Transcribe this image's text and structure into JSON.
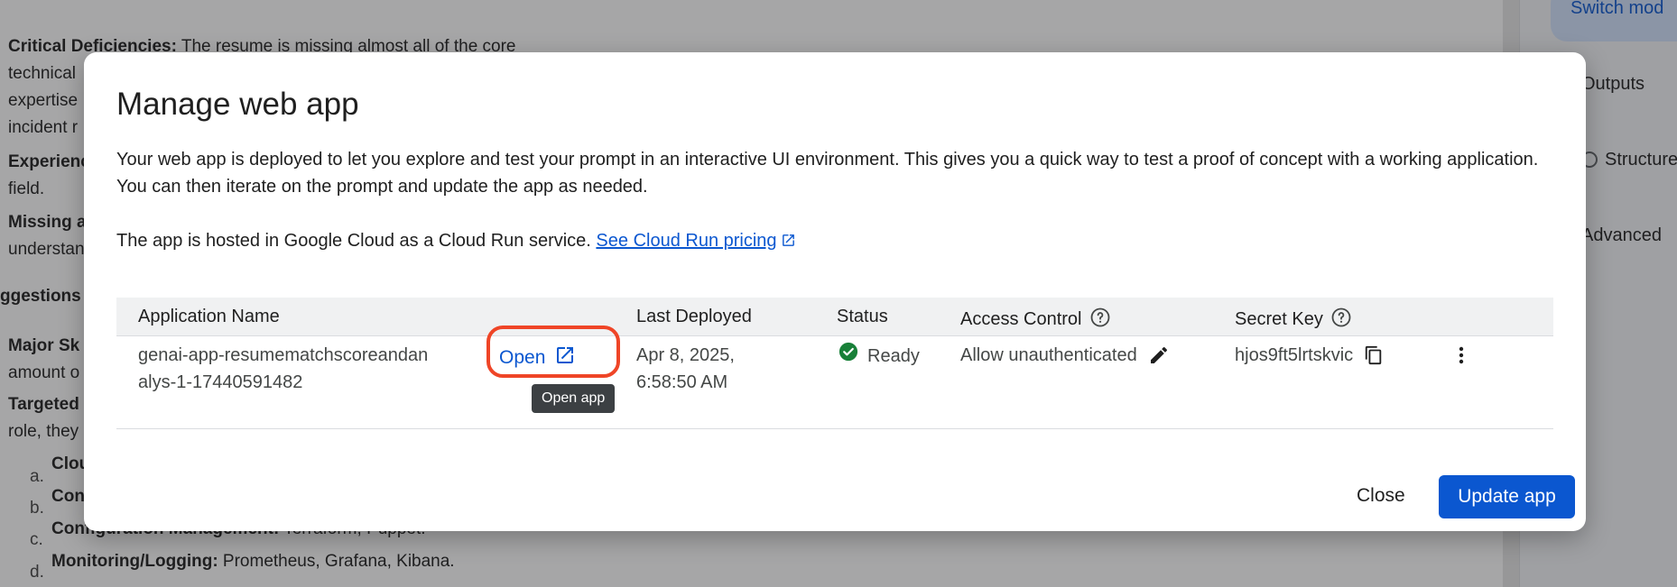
{
  "background": {
    "paragraphs": [
      {
        "bold": "Critical Deficiencies:",
        "text": " The resume is missing almost all of the core"
      },
      {
        "bold": "",
        "text": "technical"
      },
      {
        "bold": "",
        "text": "expertise"
      },
      {
        "bold": "",
        "text": "incident r"
      },
      {
        "bold": "Experienc",
        "text": ""
      },
      {
        "bold": "",
        "text": "field."
      },
      {
        "bold": "Missing a",
        "text": ""
      },
      {
        "bold": "",
        "text": "understan"
      },
      {
        "bold": "",
        "text": "ggestions fo"
      },
      {
        "bold": "Major Sk",
        "text": ""
      },
      {
        "bold": "",
        "text": "amount o"
      },
      {
        "bold": "Targeted",
        "text": ""
      },
      {
        "bold": "",
        "text": "role, they"
      }
    ],
    "list_items": [
      {
        "marker": "a.",
        "bold": "Clou",
        "text": ""
      },
      {
        "marker": "b.",
        "bold": "Con",
        "text": ""
      },
      {
        "marker": "c.",
        "bold": "Configuration Management:",
        "text": " Terraform, Puppet."
      },
      {
        "marker": "d.",
        "bold": "Monitoring/Logging:",
        "text": " Prometheus, Grafana, Kibana."
      }
    ],
    "side_panel": {
      "switch_mode": "Switch mod",
      "outputs": "Outputs",
      "structured": "Structure",
      "advanced": "Advanced"
    }
  },
  "dialog": {
    "title": "Manage web app",
    "description": "Your web app is deployed to let you explore and test your prompt in an interactive UI environment. This gives you a quick way to test a proof of concept with a working application. You can then iterate on the prompt and update the app as needed.",
    "hosted_text": "The app is hosted in Google Cloud as a Cloud Run service. ",
    "pricing_link": "See Cloud Run pricing",
    "table": {
      "headers": {
        "app_name": "Application Name",
        "last_deployed": "Last Deployed",
        "status": "Status",
        "access_control": "Access Control",
        "secret_key": "Secret Key"
      },
      "row": {
        "app_name": "genai-app-resumematchscoreandanalys-1-17440591482",
        "open_label": "Open",
        "tooltip": "Open app",
        "last_deployed": "Apr 8, 2025, 6:58:50 AM",
        "status": "Ready",
        "access_control": "Allow unauthenticated",
        "secret_key": "hjos9ft5lrtskvic"
      }
    },
    "close_label": "Close",
    "update_label": "Update app"
  },
  "colors": {
    "accent": "#0b57d0",
    "status_ready": "#188038",
    "highlight": "#ef4527",
    "tooltip_bg": "#3c4043"
  },
  "icons": {
    "open": "open-in-new-icon",
    "help": "help-circle-icon",
    "edit": "pencil-icon",
    "copy": "copy-icon",
    "more": "more-vert-icon",
    "ready": "check-circle-icon"
  }
}
